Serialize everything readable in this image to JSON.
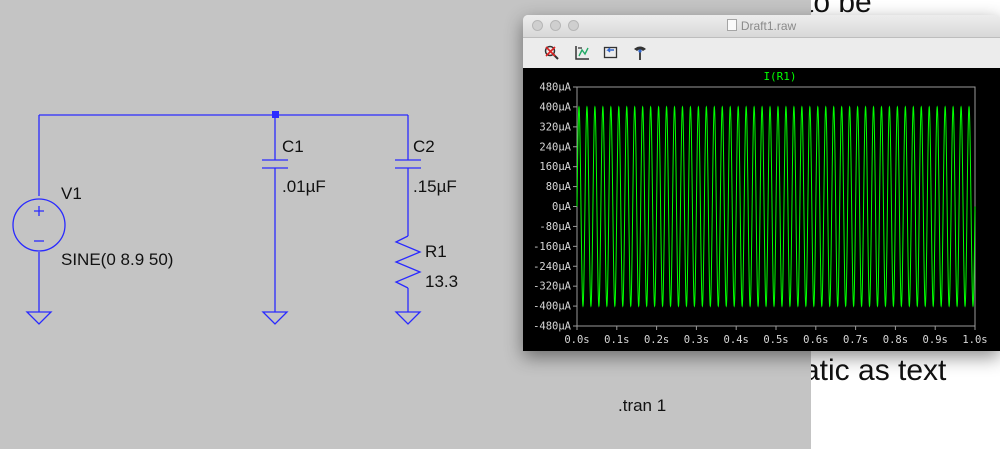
{
  "background_document": {
    "fragment_top": "to be",
    "fragment_middle": "atic as text"
  },
  "schematic": {
    "background_color": "#c4c4c4",
    "wire_color": "#2a2aff",
    "components": {
      "v1": {
        "name": "V1",
        "value": "SINE(0 8.9 50)"
      },
      "c1": {
        "name": "C1",
        "value": ".01µF"
      },
      "c2": {
        "name": "C2",
        "value": ".15µF"
      },
      "r1": {
        "name": "R1",
        "value": "13.3"
      }
    },
    "directive": ".tran 1"
  },
  "plot_window": {
    "title": "Draft1.raw",
    "toolbar": [
      {
        "name": "zoom-cancel-icon"
      },
      {
        "name": "autorange-icon"
      },
      {
        "name": "back-icon"
      },
      {
        "name": "probe-icon"
      }
    ],
    "trace_color": "#00ff00",
    "chart_data": {
      "type": "line",
      "series": [
        {
          "name": "I(R1)",
          "amplitude": 400,
          "frequency_hz": 50,
          "unit": "µA"
        }
      ],
      "x": {
        "min": 0,
        "max": 1.0,
        "ticks": [
          "0.0s",
          "0.1s",
          "0.2s",
          "0.3s",
          "0.4s",
          "0.5s",
          "0.6s",
          "0.7s",
          "0.8s",
          "0.9s",
          "1.0s"
        ]
      },
      "y": {
        "min": -480,
        "max": 480,
        "ticks": [
          "480µA",
          "400µA",
          "320µA",
          "240µA",
          "160µA",
          "80µA",
          "0µA",
          "-80µA",
          "-160µA",
          "-240µA",
          "-320µA",
          "-400µA",
          "-480µA"
        ]
      },
      "ytick_values": [
        480,
        400,
        320,
        240,
        160,
        80,
        0,
        -80,
        -160,
        -240,
        -320,
        -400,
        -480
      ],
      "xtick_values": [
        0,
        0.1,
        0.2,
        0.3,
        0.4,
        0.5,
        0.6,
        0.7,
        0.8,
        0.9,
        1.0
      ]
    }
  }
}
